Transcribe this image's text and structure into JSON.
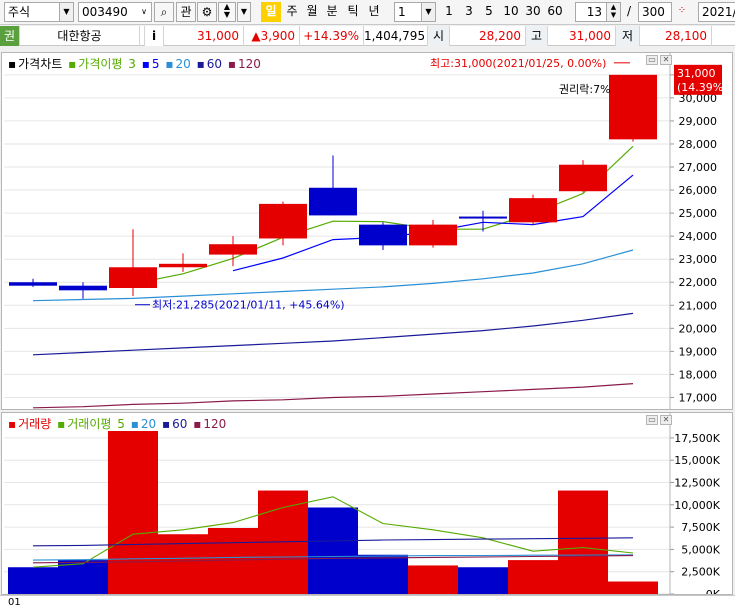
{
  "toolbar": {
    "market": "주식",
    "code": "003490",
    "btn_search": "⌕",
    "btn_interest": "관",
    "periods": [
      "일",
      "주",
      "월",
      "분",
      "틱",
      "년"
    ],
    "period_active": "일",
    "multiplier": "1",
    "quick": [
      "1",
      "3",
      "5",
      "10",
      "30",
      "60"
    ],
    "count": "13",
    "slash": "/",
    "total": "300",
    "date": "2021/"
  },
  "info": {
    "tag": "권",
    "name": "대한항공",
    "i_label": "i",
    "price": "31,000",
    "change": "▲3,900",
    "change_rate": "+14.39%",
    "volume": "1,404,795",
    "open_label": "시",
    "open": "28,200",
    "high_label": "고",
    "high": "31,000",
    "low_label": "저",
    "low": "28,100"
  },
  "colors": {
    "up": "#e50000",
    "down": "#0000cc",
    "ma3": "#55aa00",
    "ma5": "#0000ff",
    "ma20": "#2a8fd6",
    "ma60": "#1a1a99",
    "ma120": "#8b1a4a"
  },
  "price_panel": {
    "legend_title": "가격차트",
    "legend_ma_title": "가격이평",
    "ma_periods": [
      "3",
      "5",
      "20",
      "60",
      "120"
    ],
    "last_price_label": "31,000",
    "last_rate_label": "(14.39%)",
    "high_annotation": "최고:31,000(2021/01/25, 0.00%)",
    "low_annotation": "최저:21,285(2021/01/11, +45.64%)",
    "rights_annotation": "권리락:7%"
  },
  "volume_panel": {
    "legend_title": "거래량",
    "legend_ma_title": "거래이평",
    "ma_periods": [
      "5",
      "20",
      "60",
      "120"
    ]
  },
  "footer": "01",
  "chart_data": [
    {
      "type": "candlestick",
      "yticks": [
        "31,000",
        "30,000",
        "29,000",
        "28,000",
        "27,000",
        "26,000",
        "25,000",
        "24,000",
        "23,000",
        "22,000",
        "21,000",
        "20,000",
        "19,000",
        "18,000",
        "17,000"
      ],
      "ylim": [
        16500,
        31600
      ],
      "candles": [
        {
          "o": 22000,
          "h": 22150,
          "l": 21800,
          "c": 21850
        },
        {
          "o": 21850,
          "h": 22000,
          "l": 21285,
          "c": 21650
        },
        {
          "o": 21750,
          "h": 24300,
          "l": 21400,
          "c": 22650
        },
        {
          "o": 22650,
          "h": 23250,
          "l": 22450,
          "c": 22800
        },
        {
          "o": 23200,
          "h": 24000,
          "l": 22700,
          "c": 23650
        },
        {
          "o": 23900,
          "h": 25500,
          "l": 23600,
          "c": 25400
        },
        {
          "o": 26100,
          "h": 27500,
          "l": 24900,
          "c": 24900
        },
        {
          "o": 24500,
          "h": 24600,
          "l": 23400,
          "c": 23600
        },
        {
          "o": 23600,
          "h": 24700,
          "l": 23500,
          "c": 24500
        },
        {
          "o": 24850,
          "h": 25100,
          "l": 24200,
          "c": 24800
        },
        {
          "o": 24600,
          "h": 25800,
          "l": 24500,
          "c": 25650
        },
        {
          "o": 25950,
          "h": 27300,
          "l": 25900,
          "c": 27100
        },
        {
          "o": 28200,
          "h": 31000,
          "l": 28100,
          "c": 31000
        }
      ],
      "series": [
        {
          "name": "3",
          "values": [
            null,
            null,
            21933,
            22367,
            23033,
            23950,
            24650,
            24633,
            24300,
            24300,
            24983,
            25850,
            27900
          ]
        },
        {
          "name": "5",
          "values": [
            null,
            null,
            null,
            null,
            22500,
            23050,
            23850,
            23950,
            24200,
            24600,
            24500,
            24850,
            26650
          ]
        },
        {
          "name": "20",
          "values": [
            21200,
            21250,
            21300,
            21400,
            21500,
            21600,
            21700,
            21800,
            21950,
            22150,
            22400,
            22800,
            23400
          ]
        },
        {
          "name": "60",
          "values": [
            18850,
            18950,
            19050,
            19150,
            19250,
            19350,
            19450,
            19600,
            19750,
            19900,
            20100,
            20350,
            20650
          ]
        },
        {
          "name": "120",
          "values": [
            16550,
            16600,
            16700,
            16750,
            16850,
            16900,
            17000,
            17050,
            17150,
            17250,
            17350,
            17450,
            17600
          ]
        }
      ]
    },
    {
      "type": "bar",
      "yticks": [
        "17,500K",
        "15,000K",
        "12,500K",
        "10,000K",
        "7,500K",
        "5,000K",
        "2,500K",
        "0K"
      ],
      "ylim": [
        0,
        18500
      ],
      "values": [
        3000,
        3800,
        19300,
        6700,
        7400,
        11600,
        9700,
        4400,
        3200,
        3000,
        3800,
        11600,
        1400
      ],
      "series": [
        {
          "name": "5",
          "values": [
            3000,
            3400,
            6700,
            7200,
            8000,
            9700,
            10900,
            7900,
            7200,
            6300,
            4800,
            5200,
            4600
          ]
        },
        {
          "name": "20",
          "values": [
            5400,
            5450,
            5550,
            5650,
            5750,
            5850,
            5950,
            6050,
            6100,
            6150,
            6200,
            6250,
            6300
          ]
        },
        {
          "name": "60",
          "values": [
            3800,
            3850,
            3950,
            4000,
            4100,
            4150,
            4200,
            4250,
            4300,
            4300,
            4350,
            4350,
            4400
          ]
        },
        {
          "name": "120",
          "values": [
            3500,
            3550,
            3600,
            3700,
            3800,
            3900,
            4000,
            4050,
            4100,
            4150,
            4200,
            4250,
            4300
          ]
        }
      ]
    }
  ]
}
